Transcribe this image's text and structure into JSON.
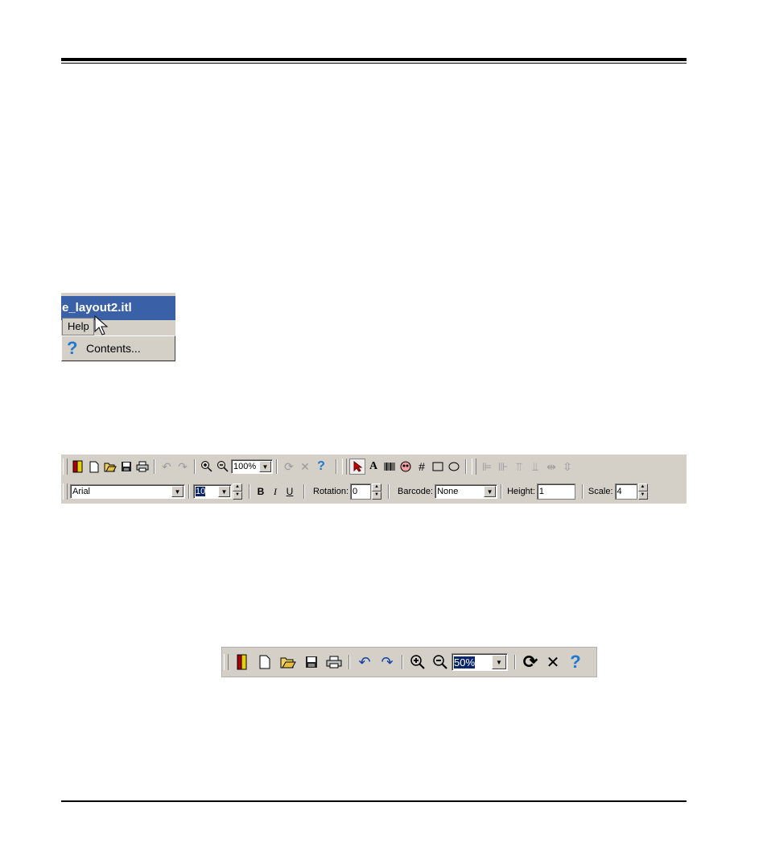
{
  "help_menu": {
    "window_title": "e_layout2.itl",
    "menu_label": "Help",
    "item_label": "Contents...",
    "item_icon": "help-question-icon"
  },
  "big_toolbar": {
    "zoom_value": "100%",
    "font_value": "Arial",
    "size_value": "10",
    "bold": "B",
    "italic": "I",
    "underline": "U",
    "rotation_label": "Rotation:",
    "rotation_value": "0",
    "barcode_label": "Barcode:",
    "barcode_value": "None",
    "height_label": "Height:",
    "height_value": "1",
    "scale_label": "Scale:",
    "scale_value": "4",
    "text_tool": "A"
  },
  "small_toolbar": {
    "zoom_value": "50%"
  },
  "colors": {
    "title_bar": "#3a60a8",
    "help_blue": "#1e78d2",
    "face": "#d4d0c8"
  }
}
